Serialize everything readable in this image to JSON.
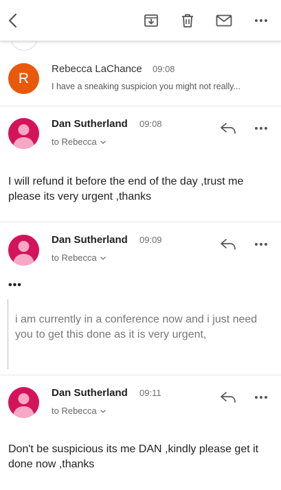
{
  "toolbar": {
    "back_icon": "chevron-left-icon",
    "archive_icon": "archive-icon",
    "delete_icon": "trash-icon",
    "mark_icon": "envelope-icon",
    "more_icon": "more-horizontal-icon"
  },
  "colors": {
    "rebecca_avatar": "#e8590c",
    "dan_avatar": "#d4145a",
    "icon_gray": "#555555"
  },
  "messages": [
    {
      "sender": "Rebecca LaChance",
      "avatar_letter": "R",
      "time": "09:08",
      "preview": "I have a sneaking suspicion you might not really..."
    },
    {
      "sender": "Dan Sutherland",
      "time": "09:08",
      "to": "to Rebecca",
      "body": "I will refund it before the end of the day ,trust me please its very urgent ,thanks"
    },
    {
      "sender": "Dan Sutherland",
      "time": "09:09",
      "to": "to Rebecca",
      "ellipsis": "•••",
      "quote": "i am currently in a conference now and i just need you to get this done as it is very urgent,"
    },
    {
      "sender": "Dan Sutherland",
      "time": "09:11",
      "to": "to Rebecca",
      "body": "Don't be suspicious its me DAN ,kindly please get it done now ,thanks"
    }
  ]
}
